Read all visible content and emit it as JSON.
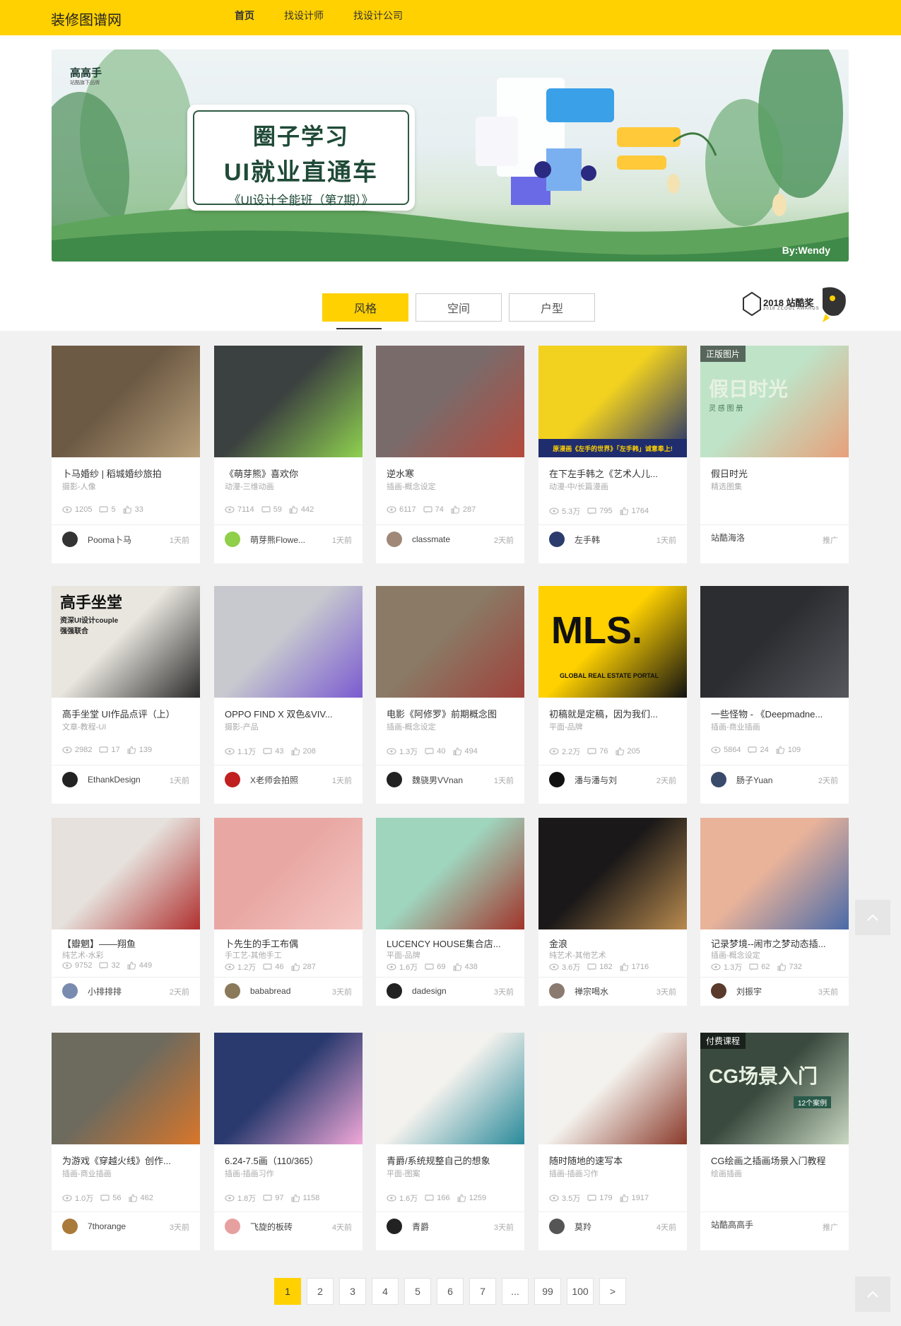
{
  "header": {
    "logo": "装修图谱网",
    "nav": [
      {
        "label": "首页"
      },
      {
        "label": "找设计师"
      },
      {
        "label": "找设计公司"
      }
    ]
  },
  "banner": {
    "brand": "高高手",
    "brand_sub": "站酷旗下品牌",
    "line1": "圈子学习",
    "line2": "UI就业直通车",
    "line3": "《UI设计全能班（第7期）》",
    "credit": "By:Wendy"
  },
  "tabs": [
    {
      "label": "风格"
    },
    {
      "label": "空间"
    },
    {
      "label": "户型"
    }
  ],
  "award": {
    "line1": "2018 站酷奖",
    "line2": "2018 ZCOOL AWARDS"
  },
  "cards": [
    {
      "title": "卜马婚纱 | 稻城婚纱旅拍",
      "category": "摄影-人像",
      "views": "1205",
      "comments": "5",
      "likes": "33",
      "author": "Pooma卜马",
      "time": "1天前",
      "thumb_color": "#6d5a45",
      "thumb_color2": "#b9a07a",
      "avatar_color": "#333333"
    },
    {
      "title": "《萌芽熊》喜欢你",
      "category": "动漫-三维动画",
      "views": "7114",
      "comments": "59",
      "likes": "442",
      "author": "萌芽熊Flowe...",
      "time": "1天前",
      "thumb_color": "#3b4040",
      "thumb_color2": "#8fd14f",
      "avatar_color": "#8fcf4a"
    },
    {
      "title": "逆水寒",
      "category": "插画-概念设定",
      "views": "6117",
      "comments": "74",
      "likes": "287",
      "author": "classmate",
      "time": "2天前",
      "thumb_color": "#7a6b6b",
      "thumb_color2": "#b44a3c",
      "avatar_color": "#a08878"
    },
    {
      "title": "在下左手韩之《艺术人儿...",
      "category": "动漫-中/长篇漫画",
      "views": "5.3万",
      "comments": "795",
      "likes": "1764",
      "author": "左手韩",
      "time": "1天前",
      "thumb_color": "#f2d21f",
      "thumb_color2": "#1f2d6e",
      "avatar_color": "#2a3b6c",
      "thumb_caption": "原漫画《左手的世界》「左手韩」诚意奉上!"
    },
    {
      "title": "假日时光",
      "category": "精选图集",
      "views": "",
      "comments": "",
      "likes": "",
      "author": "站酷海洛",
      "time": "推广",
      "thumb_color": "#bfe3c7",
      "thumb_color2": "#e7a07a",
      "avatar_color": "",
      "badge": "正版图片",
      "thumb_text": "假日时光",
      "thumb_sub": "灵 感 图 册"
    },
    {
      "title": "高手坐堂 UI作品点评（上）",
      "category": "文章-教程-UI",
      "views": "2982",
      "comments": "17",
      "likes": "139",
      "author": "EthankDesign",
      "time": "1天前",
      "thumb_color": "#e9e6df",
      "thumb_color2": "#2b2b2b",
      "avatar_color": "#222222",
      "thumb_text": "高手坐堂",
      "thumb_sub": "资深UI设计couple 强强联合"
    },
    {
      "title": "OPPO FIND X 双色&VIV...",
      "category": "摄影-产品",
      "views": "1.1万",
      "comments": "43",
      "likes": "208",
      "author": "X老师会拍照",
      "time": "1天前",
      "thumb_color": "#c7c9cf",
      "thumb_color2": "#7b5bd0",
      "avatar_color": "#c02020"
    },
    {
      "title": "电影《阿修罗》前期概念图",
      "category": "插画-概念设定",
      "views": "1.3万",
      "comments": "40",
      "likes": "494",
      "author": "魏骁男VVnan",
      "time": "1天前",
      "thumb_color": "#8a7a66",
      "thumb_color2": "#a0413a",
      "avatar_color": "#222222"
    },
    {
      "title": "初稿就是定稿，因为我们...",
      "category": "平面-品牌",
      "views": "2.2万",
      "comments": "76",
      "likes": "205",
      "author": "潘与潘与刘",
      "time": "2天前",
      "thumb_color": "#ffd100",
      "thumb_color2": "#111111",
      "avatar_color": "#111111",
      "thumb_text": "MLS.",
      "thumb_sub": "GLOBAL REAL ESTATE PORTAL"
    },
    {
      "title": "一些怪物 - 《Deepmadne...",
      "category": "插画-商业插画",
      "views": "5864",
      "comments": "24",
      "likes": "109",
      "author": "肠子Yuan",
      "time": "2天前",
      "thumb_color": "#2c2d30",
      "thumb_color2": "#55575d",
      "avatar_color": "#3a4a6a"
    },
    {
      "title": "【瓣魍】——翔鱼",
      "category": "纯艺术-水彩",
      "views": "9752",
      "comments": "32",
      "likes": "449",
      "author": "小排排排",
      "time": "2天前",
      "thumb_color": "#e6e1dc",
      "thumb_color2": "#b0302f",
      "avatar_color": "#7a8bb0"
    },
    {
      "title": "卜先生的手工布偶",
      "category": "手工艺-其他手工",
      "views": "1.2万",
      "comments": "46",
      "likes": "287",
      "author": "bababread",
      "time": "3天前",
      "thumb_color": "#e9a7a3",
      "thumb_color2": "#f4c8c4",
      "avatar_color": "#8a7a5a"
    },
    {
      "title": "LUCENCY HOUSE集合店...",
      "category": "平面-品牌",
      "views": "1.6万",
      "comments": "69",
      "likes": "438",
      "author": "dadesign",
      "time": "3天前",
      "thumb_color": "#9fd4bd",
      "thumb_color2": "#a1342a",
      "avatar_color": "#222222"
    },
    {
      "title": "金浪",
      "category": "纯艺术-其他艺术",
      "views": "3.6万",
      "comments": "182",
      "likes": "1716",
      "author": "禅宗喝水",
      "time": "3天前",
      "thumb_color": "#1a1818",
      "thumb_color2": "#b88a4e",
      "avatar_color": "#8a7a70"
    },
    {
      "title": "记录梦境--闹市之梦动态插...",
      "category": "插画-概念设定",
      "views": "1.3万",
      "comments": "62",
      "likes": "732",
      "author": "刘振宇",
      "time": "3天前",
      "thumb_color": "#e9b39a",
      "thumb_color2": "#4a6aa8",
      "avatar_color": "#5a3a2a"
    },
    {
      "title": "为游戏《穿越火线》创作...",
      "category": "插画-商业插画",
      "views": "1.0万",
      "comments": "56",
      "likes": "462",
      "author": "7thorange",
      "time": "3天前",
      "thumb_color": "#6d6a5e",
      "thumb_color2": "#d8762a",
      "avatar_color": "#aa7a3a"
    },
    {
      "title": "6.24-7.5画（110/365）",
      "category": "插画-插画习作",
      "views": "1.8万",
      "comments": "97",
      "likes": "1158",
      "author": "飞旋的板砖",
      "time": "4天前",
      "thumb_color": "#2a3a6e",
      "thumb_color2": "#f0a8d8",
      "avatar_color": "#e6a0a0"
    },
    {
      "title": "青爵/系统规整自己的想象",
      "category": "平面-图案",
      "views": "1.6万",
      "comments": "166",
      "likes": "1259",
      "author": "青爵",
      "time": "3天前",
      "thumb_color": "#f4f2ee",
      "thumb_color2": "#2a8a9a",
      "avatar_color": "#222222"
    },
    {
      "title": "随时随地的速写本",
      "category": "插画-插画习作",
      "views": "3.5万",
      "comments": "179",
      "likes": "1917",
      "author": "莫羚",
      "time": "4天前",
      "thumb_color": "#f4f2ee",
      "thumb_color2": "#8a3a2a",
      "avatar_color": "#555555"
    },
    {
      "title": "CG绘画之插画场景入门教程",
      "category": "绘画插画",
      "views": "",
      "comments": "",
      "likes": "",
      "author": "站酷高高手",
      "time": "推广",
      "thumb_color": "#3a4a3e",
      "thumb_color2": "#c8d8c2",
      "avatar_color": "",
      "badge": "付费课程",
      "thumb_text": "CG场景入门",
      "thumb_sub": "12个案例"
    }
  ],
  "pagination": [
    "1",
    "2",
    "3",
    "4",
    "5",
    "6",
    "7",
    "...",
    "99",
    "100",
    ">"
  ],
  "float": {
    "top_icon": "chevron-up-icon"
  }
}
